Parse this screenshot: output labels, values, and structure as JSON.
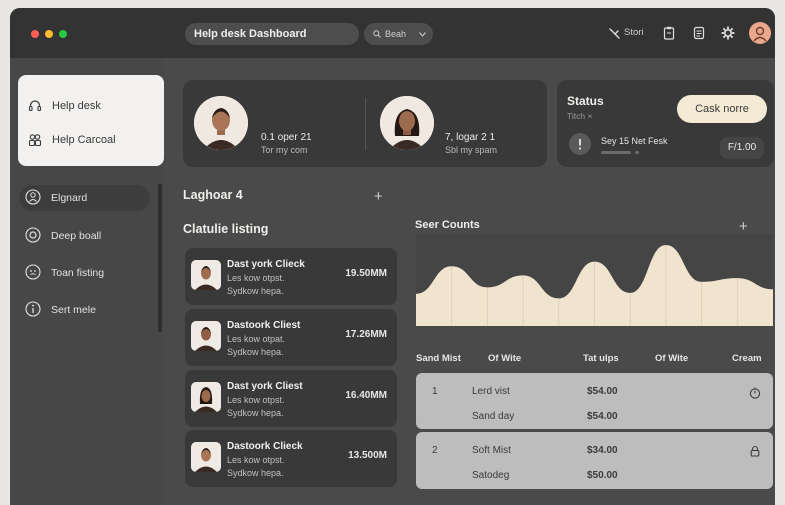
{
  "window": {
    "address_title": "Help desk Dashboard",
    "search_label": "Beah",
    "toolbar_text": "Stori"
  },
  "colors": {
    "accent": "#f5ead6",
    "card": "#393939",
    "bg": "#4a4a4a",
    "chart_fill": "#f0e4cf"
  },
  "help_card": [
    {
      "label": "Help desk",
      "icon": "headset-icon"
    },
    {
      "label": "Help Carcoal",
      "icon": "people-icon"
    }
  ],
  "nav": [
    {
      "label": "Elgnard",
      "icon": "person-icon",
      "active": true
    },
    {
      "label": "Deep boall",
      "icon": "ring-icon",
      "active": false
    },
    {
      "label": "Toan fisting",
      "icon": "chat-icon",
      "active": false
    },
    {
      "label": "Sert mele",
      "icon": "info-icon",
      "active": false
    }
  ],
  "users": [
    {
      "line1": "0.1 oper 21",
      "line2": "Tor my com"
    },
    {
      "line1": "7, logar 2 1",
      "line2": "Sbl my spam"
    }
  ],
  "status": {
    "title": "Status",
    "subtitle": "Titch ×",
    "button": "Cask norre",
    "item": "Sey 15 Net Fesk",
    "item_value": "F/1.00"
  },
  "sections": {
    "laghoar": "Laghoar 4",
    "listing": "Clatulie listing",
    "counts": "Seer Counts"
  },
  "listing": [
    {
      "name": "Dast york Clieck",
      "sub1": "Les kow otpst.",
      "sub2": "Sydkow hepa.",
      "amount": "19.50MM"
    },
    {
      "name": "Dastoork Cliest",
      "sub1": "Les kow otpat.",
      "sub2": "Sydkow hepa.",
      "amount": "17.26MM"
    },
    {
      "name": "Dast york Cliest",
      "sub1": "Les kow otpst.",
      "sub2": "Sydkow hepa.",
      "amount": "16.40MM"
    },
    {
      "name": "Dastoork Clieck",
      "sub1": "Les kow otpst.",
      "sub2": "Sydkow hepa.",
      "amount": "13.500M"
    }
  ],
  "table": {
    "headers": [
      "Sand Mist",
      "Of Wite",
      "Tat ulps",
      "Of Wite",
      "Cream"
    ],
    "groups": [
      {
        "num": "1",
        "rows": [
          {
            "name": "Lerd vist",
            "value": "$54.00"
          },
          {
            "name": "Sand day",
            "value": "$54.00"
          }
        ],
        "icon": "clock-icon"
      },
      {
        "num": "2",
        "rows": [
          {
            "name": "Soft Mist",
            "value": "$34.00"
          },
          {
            "name": "Satodeg",
            "value": "$50.00"
          }
        ],
        "icon": "lock-icon"
      }
    ]
  },
  "chart_data": {
    "type": "area",
    "title": "Seer Counts",
    "series": [
      {
        "values": [
          35,
          65,
          42,
          55,
          30,
          70,
          36,
          88,
          48,
          52,
          40
        ]
      }
    ],
    "ylim": [
      0,
      100
    ],
    "grid": false
  }
}
